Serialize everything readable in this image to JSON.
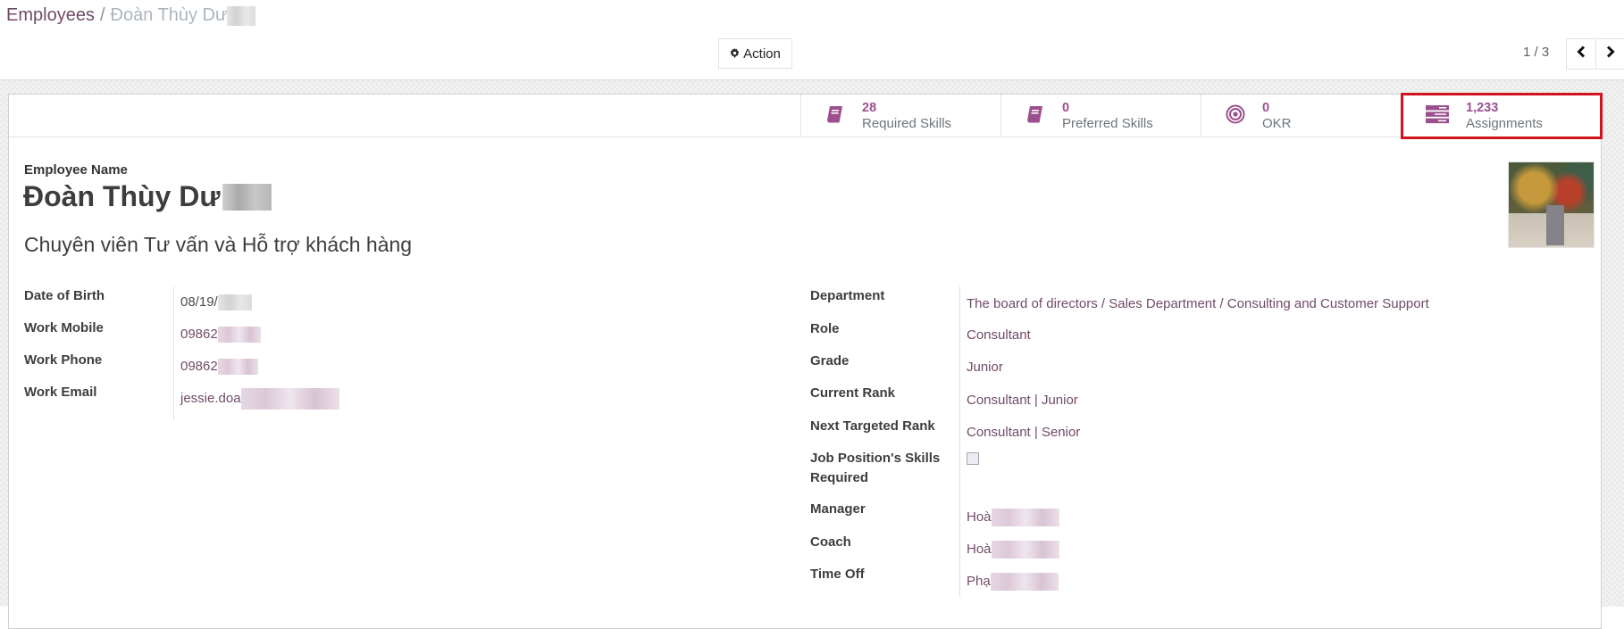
{
  "breadcrumb": {
    "parent": "Employees",
    "separator": "/",
    "current": "Đoàn Thùy Dư"
  },
  "toolbar": {
    "action_label": "Action",
    "action_icon": "gear-icon",
    "pager_value": "1 / 3",
    "pager_prev_icon": "chevron-left-icon",
    "pager_next_icon": "chevron-right-icon"
  },
  "stat_buttons": [
    {
      "value": "28",
      "label": "Required Skills",
      "icon": "book-icon"
    },
    {
      "value": "0",
      "label": "Preferred Skills",
      "icon": "book-icon"
    },
    {
      "value": "0",
      "label": "OKR",
      "icon": "target-icon"
    },
    {
      "value": "1,233",
      "label": "Assignments",
      "icon": "tasks-icon",
      "highlighted": true
    }
  ],
  "employee": {
    "name_label": "Employee Name",
    "name": "Đoàn Thùy Dư",
    "job_title": "Chuyên viên Tư vấn và Hỗ trợ khách hàng"
  },
  "left_fields": [
    {
      "label": "Date of Birth",
      "value": "08/19/"
    },
    {
      "label": "Work Mobile",
      "value": "09862"
    },
    {
      "label": "Work Phone",
      "value": "09862"
    },
    {
      "label": "Work Email",
      "value": "jessie.doa"
    }
  ],
  "right_fields": [
    {
      "label": "Department",
      "value": "The board of directors / Sales Department / Consulting and Customer Support"
    },
    {
      "label": "Role",
      "value": "Consultant"
    },
    {
      "label": "Grade",
      "value": "Junior"
    },
    {
      "label": "Current Rank",
      "value": "Consultant | Junior"
    },
    {
      "label": "Next Targeted Rank",
      "value": "Consultant | Senior"
    },
    {
      "label": "Job Position's Skills Required",
      "checked": false
    },
    {
      "label": "Manager",
      "value": "Hoà"
    },
    {
      "label": "Coach",
      "value": "Hoà"
    },
    {
      "label": "Time Off",
      "value": "Phạ"
    }
  ],
  "colors": {
    "brand": "#714b67",
    "stat_value": "#9b4f8e",
    "highlight_border": "#d0131d"
  }
}
